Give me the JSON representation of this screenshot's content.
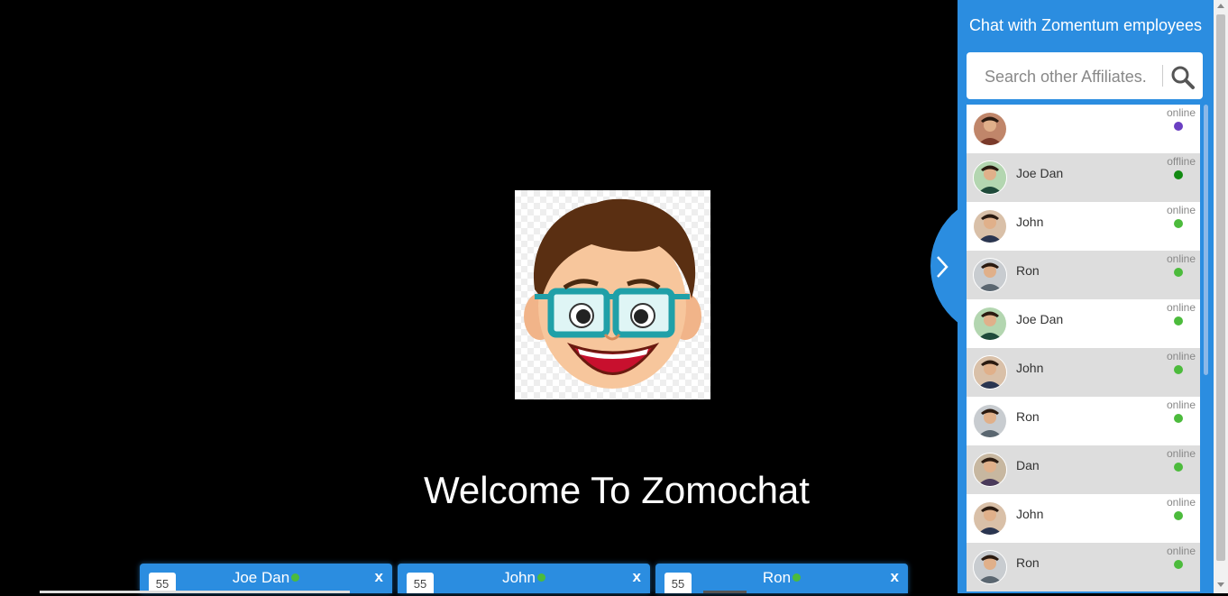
{
  "main": {
    "welcome_text": "Welcome To Zomochat"
  },
  "chat_tabs": [
    {
      "count": "55",
      "name": "Joe Dan",
      "close": "x"
    },
    {
      "count": "55",
      "name": "John",
      "close": "x"
    },
    {
      "count": "55",
      "name": "Ron",
      "close": "x"
    }
  ],
  "sidebar": {
    "title": "Chat with Zomentum employees",
    "search_placeholder": "Search other Affiliates.",
    "users": [
      {
        "name": "",
        "status": "online",
        "dot_color": "#6a3fc2"
      },
      {
        "name": "Joe Dan",
        "status": "offline",
        "dot_color": "#128a12"
      },
      {
        "name": "John",
        "status": "online",
        "dot_color": "#4cbb3c"
      },
      {
        "name": "Ron",
        "status": "online",
        "dot_color": "#4cbb3c"
      },
      {
        "name": "Joe Dan",
        "status": "online",
        "dot_color": "#4cbb3c"
      },
      {
        "name": "John",
        "status": "online",
        "dot_color": "#4cbb3c"
      },
      {
        "name": "Ron",
        "status": "online",
        "dot_color": "#4cbb3c"
      },
      {
        "name": "Dan",
        "status": "online",
        "dot_color": "#4cbb3c"
      },
      {
        "name": "John",
        "status": "online",
        "dot_color": "#4cbb3c"
      },
      {
        "name": "Ron",
        "status": "online",
        "dot_color": "#4cbb3c"
      }
    ]
  },
  "colors": {
    "accent": "#2b8de0",
    "online": "#4cbb3c"
  }
}
